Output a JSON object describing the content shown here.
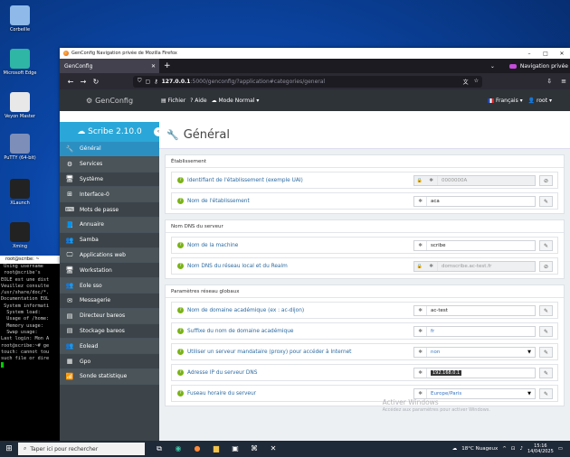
{
  "desktop": {
    "icons": [
      {
        "label": "Corbeille",
        "color": "#8fb9e8"
      },
      {
        "label": "Microsoft Edge",
        "color": "#2fb6a4"
      },
      {
        "label": "Veyon Master",
        "color": "#e8e8e8"
      },
      {
        "label": "PuTTY (64-bit)",
        "color": "#7d8fb8"
      },
      {
        "label": "XLaunch",
        "color": "#222222"
      },
      {
        "label": "Xming",
        "color": "#222222"
      }
    ]
  },
  "terminal": {
    "title": "root@scribe: ~",
    "lines": [
      " Using username",
      " root@scribe's",
      "",
      "EOLE est une dist",
      "Veuillez consulte",
      "/usr/share/doc/*.",
      "",
      "Documentation EOL",
      "",
      " System informati",
      "",
      "  System load:",
      "  Usage of /home:",
      "  Memory usage:",
      "  Swap usage:",
      "",
      "",
      "Last login: Mon A",
      "root@scribe:~# ge",
      "touch: cannot tou",
      "such file or dire"
    ]
  },
  "browser": {
    "window_title": "GenConfig Navigation privée de Mozilla Firefox",
    "tab_label": "GenConfig",
    "private_label": "Navigation privée",
    "url_host": "127.0.0.1",
    "url_rest": ":5000/genconfig/?application#categories/general"
  },
  "app": {
    "brand": "GenConfig",
    "menu": {
      "file": "Fichier",
      "help": "Aide",
      "mode": "Mode Normal"
    },
    "language": "Français",
    "user": "root",
    "version": "Scribe 2.10.0"
  },
  "sidebar": {
    "items": [
      {
        "label": "Général",
        "icon": "wrench-icon",
        "glyph": "🔧",
        "active": true
      },
      {
        "label": "Services",
        "icon": "cogs-icon",
        "glyph": "⚙"
      },
      {
        "label": "Système",
        "icon": "monitor-icon",
        "glyph": "🖥"
      },
      {
        "label": "Interface-0",
        "icon": "network-icon",
        "glyph": "⊞"
      },
      {
        "label": "Mots de passe",
        "icon": "keyboard-icon",
        "glyph": "⌨"
      },
      {
        "label": "Annuaire",
        "icon": "book-icon",
        "glyph": "📘"
      },
      {
        "label": "Samba",
        "icon": "users-icon",
        "glyph": "👥"
      },
      {
        "label": "Applications web",
        "icon": "globe-icon",
        "glyph": "🖵"
      },
      {
        "label": "Workstation",
        "icon": "desktop-icon",
        "glyph": "🖥"
      },
      {
        "label": "Eole sso",
        "icon": "users-icon",
        "glyph": "👥"
      },
      {
        "label": "Messagerie",
        "icon": "mail-icon",
        "glyph": "✉"
      },
      {
        "label": "Directeur bareos",
        "icon": "server-icon",
        "glyph": "▤"
      },
      {
        "label": "Stockage bareos",
        "icon": "storage-icon",
        "glyph": "▤"
      },
      {
        "label": "Eolead",
        "icon": "users-icon",
        "glyph": "👥"
      },
      {
        "label": "Gpo",
        "icon": "grid-icon",
        "glyph": "▦"
      },
      {
        "label": "Sonde statistique",
        "icon": "chart-icon",
        "glyph": "📶"
      }
    ]
  },
  "page": {
    "title": "Général",
    "sections": [
      {
        "title": "Établissement",
        "rows": [
          {
            "label": "Identifiant de l'établissement (exemple UAI)",
            "value": "0000000A",
            "readonly": true,
            "locked": true
          },
          {
            "label": "Nom de l'établissement",
            "value": "aca"
          }
        ]
      },
      {
        "title": "Nom DNS du serveur",
        "rows": [
          {
            "label": "Nom de la machine",
            "value": "scribe"
          },
          {
            "label": "Nom DNS du réseau local et du Realm",
            "value": "domscribe.ac-test.fr",
            "readonly": true,
            "locked": true
          }
        ]
      },
      {
        "title": "Paramètres réseau globaux",
        "rows": [
          {
            "label": "Nom de domaine académique (ex : ac-dijon)",
            "value": "ac-test"
          },
          {
            "label": "Suffixe du nom de domaine académique",
            "value": "fr",
            "blue": true
          },
          {
            "label": "Utiliser un serveur mandataire (proxy) pour accéder à Internet",
            "value": "non",
            "select": true
          },
          {
            "label": "Adresse IP du serveur DNS",
            "value": "192.168.0.1",
            "ip": true
          },
          {
            "label": "Fuseau horaire du serveur",
            "value": "Europe/Paris",
            "select": true
          }
        ]
      }
    ]
  },
  "watermark": {
    "title": "Activer Windows",
    "sub": "Accédez aux paramètres pour activer Windows."
  },
  "taskbar": {
    "search_placeholder": "Taper ici pour rechercher",
    "weather": "18°C Nuageux",
    "time": "15:16",
    "date": "14/04/2025"
  }
}
